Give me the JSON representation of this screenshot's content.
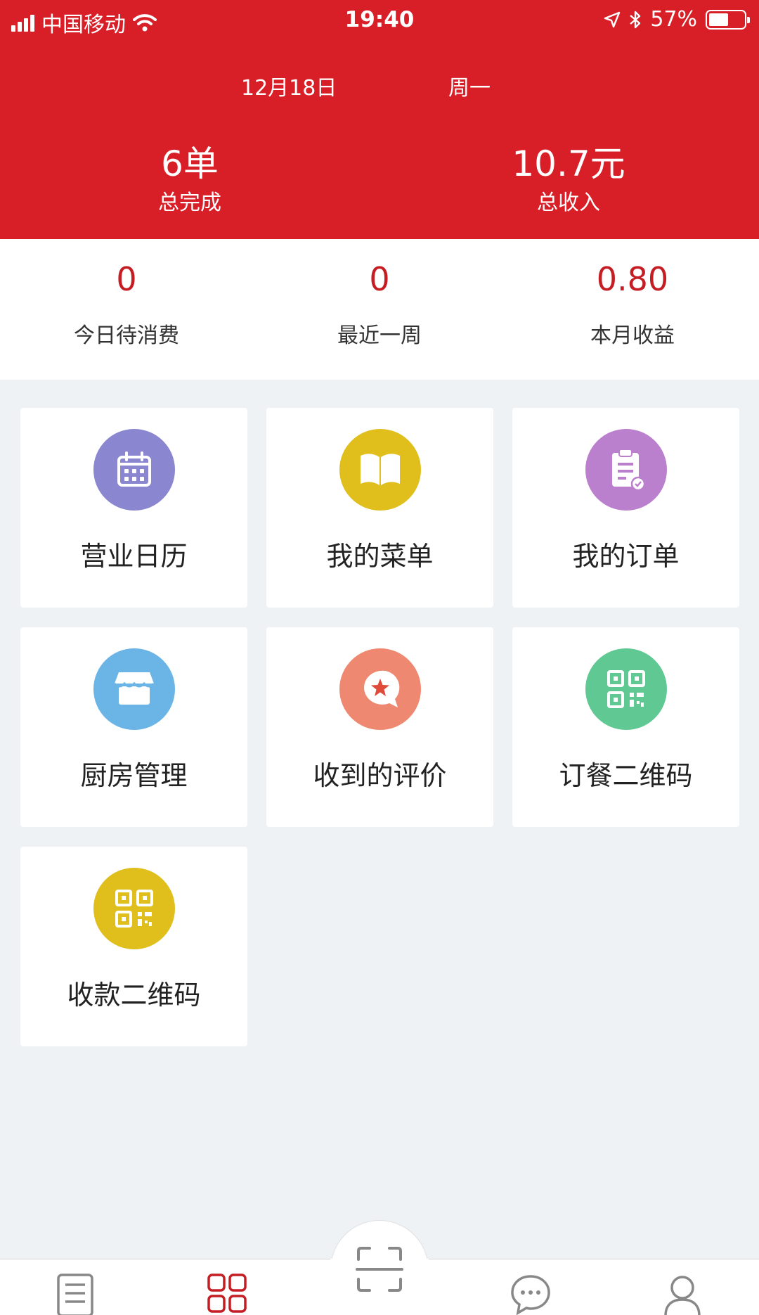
{
  "status_bar": {
    "carrier": "中国移动",
    "time": "19:40",
    "battery": "57%",
    "battery_level": 0.57
  },
  "header": {
    "date": "12月18日",
    "weekday": "周一",
    "completed_value": "6单",
    "completed_label": "总完成",
    "income_value": "10.7元",
    "income_label": "总收入"
  },
  "stats": [
    {
      "value": "0",
      "label": "今日待消费"
    },
    {
      "value": "0",
      "label": "最近一周"
    },
    {
      "value": "0.80",
      "label": "本月收益"
    }
  ],
  "menu": [
    {
      "label": "营业日历",
      "icon": "calendar-icon",
      "color": "#8a86cf"
    },
    {
      "label": "我的菜单",
      "icon": "book-icon",
      "color": "#e0be1c"
    },
    {
      "label": "我的订单",
      "icon": "clipboard-icon",
      "color": "#bb80cd"
    },
    {
      "label": "厨房管理",
      "icon": "store-icon",
      "color": "#6ab4e6"
    },
    {
      "label": "收到的评价",
      "icon": "review-icon",
      "color": "#ef8870"
    },
    {
      "label": "订餐二维码",
      "icon": "qr-code-icon",
      "color": "#5fc893"
    },
    {
      "label": "收款二维码",
      "icon": "qr-code-icon",
      "color": "#e0be1c"
    }
  ],
  "tabbar": {
    "active_color": "#c41e24",
    "items": [
      "list-icon",
      "grid-icon",
      "scan-icon",
      "chat-icon",
      "user-icon"
    ]
  }
}
